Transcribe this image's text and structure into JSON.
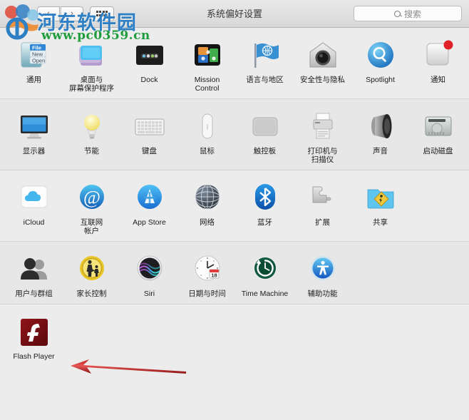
{
  "window": {
    "title": "系统偏好设置",
    "back_label": "‹",
    "forward_label": "›",
    "grid_label": "show-all-grid"
  },
  "search": {
    "placeholder": "搜索",
    "value": ""
  },
  "rows": [
    {
      "name": "personal-row",
      "items": [
        {
          "label": "通用",
          "icon": "general-icon"
        },
        {
          "label": "桌面与\n屏幕保护程序",
          "icon": "desktop-screensaver-icon"
        },
        {
          "label": "Dock",
          "icon": "dock-icon"
        },
        {
          "label": "Mission\nControl",
          "icon": "mission-control-icon"
        },
        {
          "label": "语言与地区",
          "icon": "language-region-icon"
        },
        {
          "label": "安全性与隐私",
          "icon": "security-privacy-icon"
        },
        {
          "label": "Spotlight",
          "icon": "spotlight-icon"
        },
        {
          "label": "通知",
          "icon": "notifications-icon",
          "badge": true
        }
      ]
    },
    {
      "name": "hardware-row",
      "items": [
        {
          "label": "显示器",
          "icon": "displays-icon"
        },
        {
          "label": "节能",
          "icon": "energy-saver-icon"
        },
        {
          "label": "键盘",
          "icon": "keyboard-icon"
        },
        {
          "label": "鼠标",
          "icon": "mouse-icon"
        },
        {
          "label": "触控板",
          "icon": "trackpad-icon"
        },
        {
          "label": "打印机与\n扫描仪",
          "icon": "printers-scanners-icon"
        },
        {
          "label": "声音",
          "icon": "sound-icon"
        },
        {
          "label": "启动磁盘",
          "icon": "startup-disk-icon"
        }
      ]
    },
    {
      "name": "internet-row",
      "items": [
        {
          "label": "iCloud",
          "icon": "icloud-icon"
        },
        {
          "label": "互联网\n帐户",
          "icon": "internet-accounts-icon"
        },
        {
          "label": "App Store",
          "icon": "app-store-icon"
        },
        {
          "label": "网络",
          "icon": "network-icon"
        },
        {
          "label": "蓝牙",
          "icon": "bluetooth-icon"
        },
        {
          "label": "扩展",
          "icon": "extensions-icon"
        },
        {
          "label": "共享",
          "icon": "sharing-icon"
        }
      ]
    },
    {
      "name": "system-row",
      "items": [
        {
          "label": "用户与群组",
          "icon": "users-groups-icon"
        },
        {
          "label": "家长控制",
          "icon": "parental-controls-icon"
        },
        {
          "label": "Siri",
          "icon": "siri-icon"
        },
        {
          "label": "日期与时间",
          "icon": "date-time-icon",
          "day": "18"
        },
        {
          "label": "Time Machine",
          "icon": "time-machine-icon"
        },
        {
          "label": "辅助功能",
          "icon": "accessibility-icon"
        }
      ]
    },
    {
      "name": "other-row",
      "items": [
        {
          "label": "Flash Player",
          "icon": "flash-player-icon"
        }
      ]
    }
  ],
  "annotation": {
    "name": "red-arrow",
    "color": "#b01b1b",
    "points_to": "Flash Player"
  },
  "watermark": {
    "title": "河东软件园",
    "url": "www.pc0359.cn",
    "title_color": "#2f7fc4",
    "url_color": "#1f9d3c"
  }
}
